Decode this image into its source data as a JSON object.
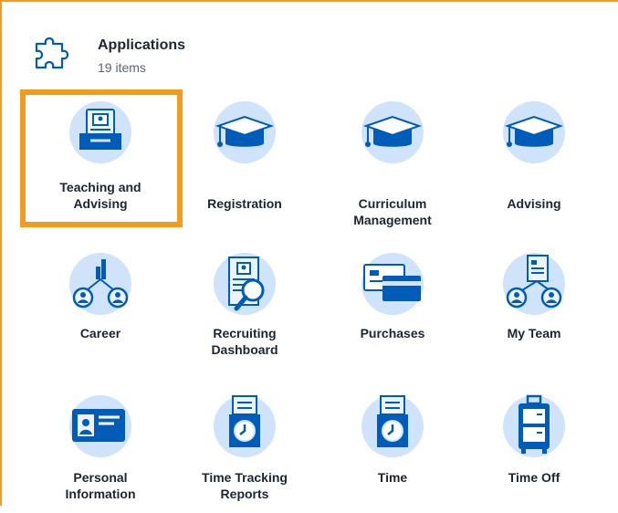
{
  "header": {
    "title": "Applications",
    "count": "19 items",
    "icon": "puzzle-icon"
  },
  "colors": {
    "accent": "#f19c1f",
    "icon_blue": "#005cb9",
    "icon_light": "#cfe3fb"
  },
  "apps": [
    {
      "label": "Teaching and Advising",
      "icon": "inbox-profile-icon",
      "highlighted": true
    },
    {
      "label": "Registration",
      "icon": "graduation-cap-icon"
    },
    {
      "label": "Curriculum Management",
      "icon": "graduation-cap-icon"
    },
    {
      "label": "Advising",
      "icon": "graduation-cap-icon"
    },
    {
      "label": "Career",
      "icon": "career-chart-icon"
    },
    {
      "label": "Recruiting Dashboard",
      "icon": "resume-magnifier-icon"
    },
    {
      "label": "Purchases",
      "icon": "credit-cards-icon"
    },
    {
      "label": "My Team",
      "icon": "team-document-icon"
    },
    {
      "label": "Personal Information",
      "icon": "id-card-icon"
    },
    {
      "label": "Time Tracking Reports",
      "icon": "time-tracking-icon"
    },
    {
      "label": "Time",
      "icon": "clock-clipboard-icon"
    },
    {
      "label": "Time Off",
      "icon": "suitcase-icon"
    }
  ]
}
